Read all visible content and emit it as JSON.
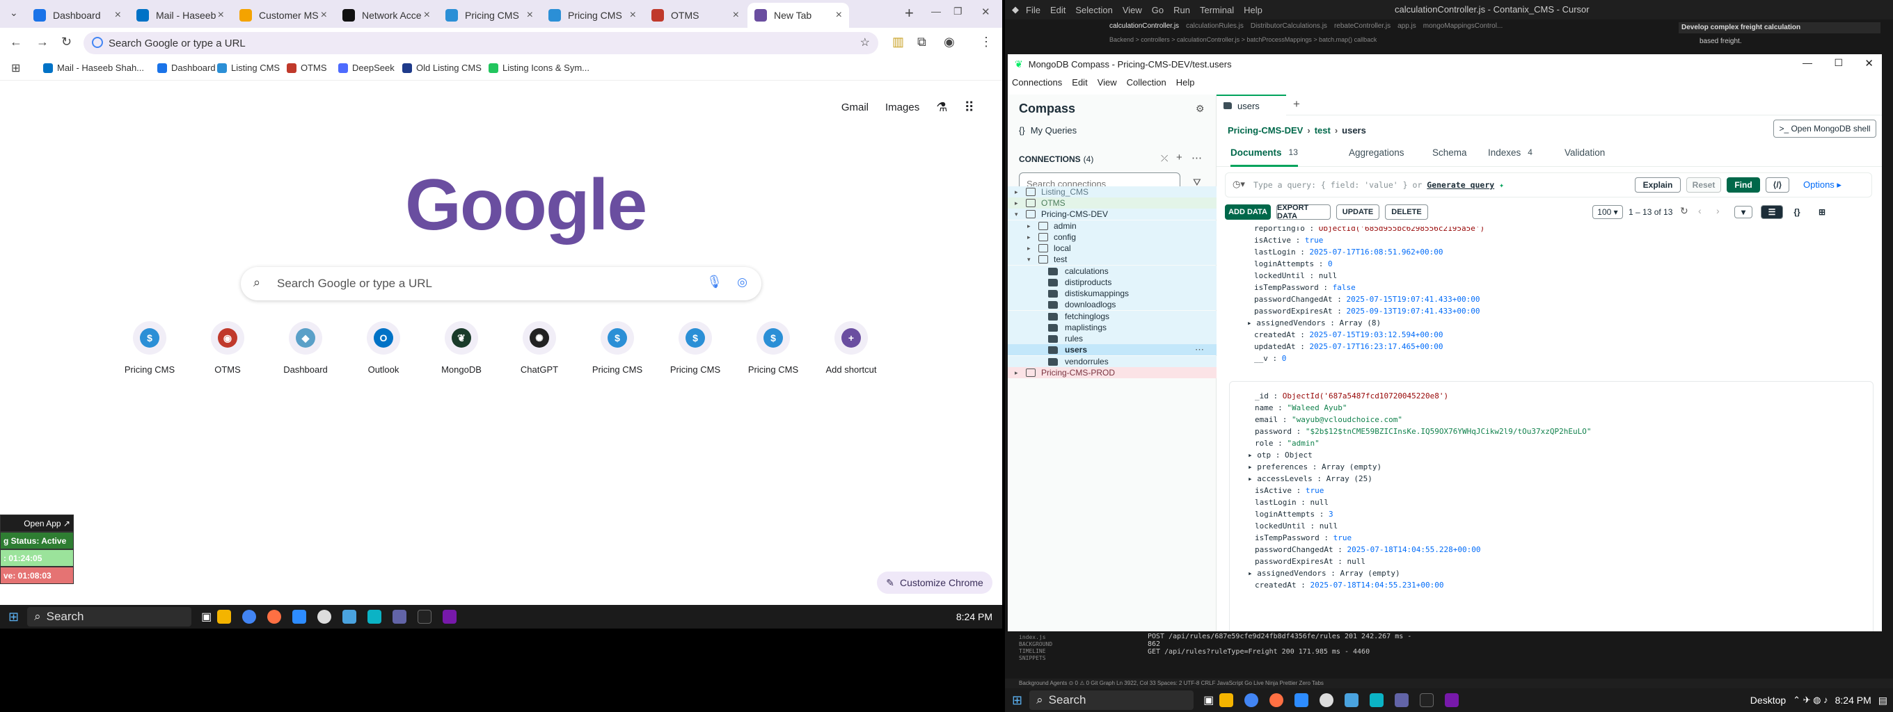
{
  "chrome": {
    "tabs": [
      {
        "label": "Dashboard",
        "color": "#1a73e8"
      },
      {
        "label": "Mail - Haseeb",
        "color": "#0072c6"
      },
      {
        "label": "Customer MS",
        "color": "#f4a300"
      },
      {
        "label": "Network Acce",
        "color": "#111111"
      },
      {
        "label": "Pricing CMS",
        "color": "#2b8fd6"
      },
      {
        "label": "Pricing CMS",
        "color": "#2b8fd6"
      },
      {
        "label": "OTMS",
        "color": "#c0392b"
      },
      {
        "label": "New Tab",
        "color": "#6a4ea0"
      }
    ],
    "omnibox_placeholder": "Search Google or type a URL",
    "bookmarks": [
      {
        "label": "Mail - Haseeb Shah...",
        "color": "#0072c6"
      },
      {
        "label": "Dashboard",
        "color": "#1a73e8"
      },
      {
        "label": "Listing CMS",
        "color": "#2b8fd6"
      },
      {
        "label": "OTMS",
        "color": "#c0392b"
      },
      {
        "label": "DeepSeek",
        "color": "#4d6bfe"
      },
      {
        "label": "Old Listing CMS",
        "color": "#1e3a8a"
      },
      {
        "label": "Listing Icons & Sym...",
        "color": "#22c55e"
      }
    ],
    "top_links": {
      "gmail": "Gmail",
      "images": "Images"
    },
    "logo": "Google",
    "search_placeholder": "Search Google or type a URL",
    "shortcuts": [
      {
        "label": "Pricing CMS",
        "glyph": "$",
        "color": "#2b8fd6"
      },
      {
        "label": "OTMS",
        "glyph": "◉",
        "color": "#c0392b"
      },
      {
        "label": "Dashboard",
        "glyph": "◆",
        "color": "#5aa0c8"
      },
      {
        "label": "Outlook",
        "glyph": "O",
        "color": "#0072c6"
      },
      {
        "label": "MongoDB",
        "glyph": "❦",
        "color": "#1a3b2a"
      },
      {
        "label": "ChatGPT",
        "glyph": "✺",
        "color": "#222222"
      },
      {
        "label": "Pricing CMS",
        "glyph": "$",
        "color": "#2b8fd6"
      },
      {
        "label": "Pricing CMS",
        "glyph": "$",
        "color": "#2b8fd6"
      },
      {
        "label": "Pricing CMS",
        "glyph": "$",
        "color": "#2b8fd6"
      },
      {
        "label": "Add shortcut",
        "glyph": "+",
        "color": "#6a4ea0"
      }
    ],
    "customize": "Customize Chrome"
  },
  "widget": {
    "open_app": "Open App ↗",
    "status": "g Status: Active",
    "time1": ": 01:24:05",
    "time2": "ve: 01:08:03"
  },
  "taskbar_left": {
    "search": "Search",
    "clock": "8:24 PM"
  },
  "taskbar_right": {
    "search": "Search",
    "desktop": "Desktop",
    "clock": "8:24 PM"
  },
  "cursor": {
    "title": "calculationController.js - Contanix_CMS - Cursor",
    "menu": [
      "File",
      "Edit",
      "Selection",
      "View",
      "Go",
      "Run",
      "Terminal",
      "Help"
    ],
    "editor_tabs": [
      "calculationController.js",
      "calculationRules.js",
      "DistributorCalculations.js",
      "rebateController.js",
      "app.js",
      "mongoMappingsControl..."
    ],
    "breadcrumb": "Backend > controllers > calculationController.js > batchProcessMappings > batch.map() callback",
    "chat_title": "Develop complex freight calculation",
    "chat_sub": "based freight.",
    "terminal": [
      "POST /api/rules/687e59cfe9d24fb8df4356fe/rules 201 242.267 ms -",
      "862",
      "GET /api/rules?ruleType=Freight 200 171.985 ms - 4460"
    ],
    "side_items": [
      "index.js",
      "BACKGROUND",
      "TIMELINE",
      "SNIPPETS"
    ],
    "status_bar": "Background Agents   ⊙ 0 ⚠ 0   Git Graph   Ln 3922, Col 33   Spaces: 2   UTF-8   CRLF   JavaScript   Go Live   Ninja   Prettier   Zero Tabs"
  },
  "compass": {
    "window_title": "MongoDB Compass - Pricing-CMS-DEV/test.users",
    "menu": [
      "Connections",
      "Edit",
      "View",
      "Collection",
      "Help"
    ],
    "brand": "Compass",
    "my_queries": "My Queries",
    "connections_label": "CONNECTIONS",
    "connections_count": "(4)",
    "search_placeholder": "Search connections",
    "tree": [
      {
        "label": "Listing_CMS",
        "level": 0,
        "kind": "conn",
        "bg": "#e3f4fb",
        "color": "#5f7a87"
      },
      {
        "label": "OTMS",
        "level": 0,
        "kind": "conn",
        "bg": "#e3f4e8",
        "color": "#4b7d5b"
      },
      {
        "label": "Pricing-CMS-DEV",
        "level": 0,
        "kind": "conn",
        "open": true,
        "bg": "#e3f4fb",
        "color": "#1c2d38"
      },
      {
        "label": "admin",
        "level": 1,
        "kind": "db",
        "bg": "#e3f4fb"
      },
      {
        "label": "config",
        "level": 1,
        "kind": "db",
        "bg": "#e3f4fb"
      },
      {
        "label": "local",
        "level": 1,
        "kind": "db",
        "bg": "#e3f4fb"
      },
      {
        "label": "test",
        "level": 1,
        "kind": "db",
        "open": true,
        "bg": "#e3f4fb"
      },
      {
        "label": "calculations",
        "level": 2,
        "kind": "coll",
        "bg": "#e3f4fb"
      },
      {
        "label": "distiproducts",
        "level": 2,
        "kind": "coll",
        "bg": "#e3f4fb"
      },
      {
        "label": "distiskumappings",
        "level": 2,
        "kind": "coll",
        "bg": "#e3f4fb"
      },
      {
        "label": "downloadlogs",
        "level": 2,
        "kind": "coll",
        "bg": "#e3f4fb"
      },
      {
        "label": "fetchinglogs",
        "level": 2,
        "kind": "coll",
        "bg": "#e3f4fb"
      },
      {
        "label": "maplistings",
        "level": 2,
        "kind": "coll",
        "bg": "#e3f4fb"
      },
      {
        "label": "rules",
        "level": 2,
        "kind": "coll",
        "bg": "#e3f4fb"
      },
      {
        "label": "users",
        "level": 2,
        "kind": "coll",
        "selected": true,
        "bg": "#c3e7fa"
      },
      {
        "label": "vendorrules",
        "level": 2,
        "kind": "coll",
        "bg": "#e3f4fb"
      },
      {
        "label": "Pricing-CMS-PROD",
        "level": 0,
        "kind": "conn",
        "bg": "#fbe3e6",
        "color": "#7a3440"
      }
    ],
    "tab": "users",
    "breadcrumb": [
      "Pricing-CMS-DEV",
      "test",
      "users"
    ],
    "open_shell": ">_ Open MongoDB shell",
    "subtabs": [
      {
        "label": "Documents",
        "count": "13"
      },
      {
        "label": "Aggregations",
        "count": ""
      },
      {
        "label": "Schema",
        "count": ""
      },
      {
        "label": "Indexes",
        "count": "4"
      },
      {
        "label": "Validation",
        "count": ""
      }
    ],
    "query_placeholder": "Type a query: { field: 'value' } or",
    "generate_query": "Generate query",
    "buttons": {
      "explain": "Explain",
      "reset": "Reset",
      "find": "Find",
      "options": "Options ▸"
    },
    "actions": {
      "add": "ADD DATA",
      "export": "EXPORT DATA",
      "update": "UPDATE",
      "delete": "DELETE"
    },
    "page_size": "100",
    "page_range": "1 – 13 of 13",
    "doc1": [
      [
        "reportingTo",
        "ObjectId('685d955bc6298556c2195a5e')",
        "o"
      ],
      [
        "isActive",
        "true",
        "b"
      ],
      [
        "lastLogin",
        "2025-07-17T16:08:51.962+00:00",
        "n"
      ],
      [
        "loginAttempts",
        "0",
        "n"
      ],
      [
        "lockedUntil",
        "null",
        "nl"
      ],
      [
        "isTempPassword",
        "false",
        "b"
      ],
      [
        "passwordChangedAt",
        "2025-07-15T19:07:41.433+00:00",
        "n"
      ],
      [
        "passwordExpiresAt",
        "2025-09-13T19:07:41.433+00:00",
        "n"
      ],
      [
        "▸ assignedVendors",
        "Array (8)",
        "nl"
      ],
      [
        "createdAt",
        "2025-07-15T19:03:12.594+00:00",
        "n"
      ],
      [
        "updatedAt",
        "2025-07-17T16:23:17.465+00:00",
        "n"
      ],
      [
        "__v",
        "0",
        "n"
      ]
    ],
    "doc2": [
      [
        "_id",
        "ObjectId('687a5487fcd10720045220e8')",
        "o"
      ],
      [
        "name",
        "\"Waleed Ayub\"",
        "s"
      ],
      [
        "email",
        "\"wayub@vcloudchoice.com\"",
        "s"
      ],
      [
        "password",
        "\"$2b$12$tnCME59BZICInsKe.IQ59OX76YWHqJCikw2l9/tOu37xzQP2hEuLO\"",
        "s"
      ],
      [
        "role",
        "\"admin\"",
        "s"
      ],
      [
        "▸ otp",
        "Object",
        "nl"
      ],
      [
        "▸ preferences",
        "Array (empty)",
        "nl"
      ],
      [
        "▸ accessLevels",
        "Array (25)",
        "nl"
      ],
      [
        "isActive",
        "true",
        "b"
      ],
      [
        "lastLogin",
        "null",
        "nl"
      ],
      [
        "loginAttempts",
        "3",
        "n"
      ],
      [
        "lockedUntil",
        "null",
        "nl"
      ],
      [
        "isTempPassword",
        "true",
        "b"
      ],
      [
        "passwordChangedAt",
        "2025-07-18T14:04:55.228+00:00",
        "n"
      ],
      [
        "passwordExpiresAt",
        "null",
        "nl"
      ],
      [
        "▸ assignedVendors",
        "Array (empty)",
        "nl"
      ],
      [
        "createdAt",
        "2025-07-18T14:04:55.231+00:00",
        "n"
      ]
    ]
  }
}
